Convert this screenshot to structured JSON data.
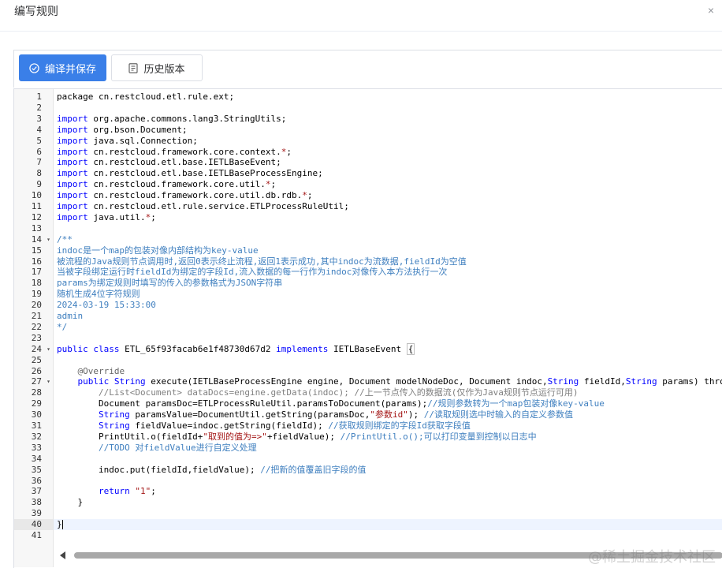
{
  "dialog": {
    "title": "编写规则",
    "close_glyph": "×"
  },
  "toolbar": {
    "save_label": "编译并保存",
    "history_label": "历史版本"
  },
  "colors": {
    "primary": "#3a7fe8",
    "keyword": "#0000ff",
    "comment": "#3f7fbf",
    "string": "#a31515"
  },
  "editor": {
    "active_line": 40,
    "fold_lines": [
      14,
      24,
      27
    ],
    "lines": [
      [
        {
          "t": "package cn.restcloud.etl.rule.ext;"
        }
      ],
      [],
      [
        {
          "t": "import",
          "c": "k"
        },
        {
          "t": " org.apache.commons.lang3.StringUtils;"
        }
      ],
      [
        {
          "t": "import",
          "c": "k"
        },
        {
          "t": " org.bson.Document;"
        }
      ],
      [
        {
          "t": "import",
          "c": "k"
        },
        {
          "t": " java.sql.Connection;"
        }
      ],
      [
        {
          "t": "import",
          "c": "k"
        },
        {
          "t": " cn.restcloud.framework.core.context."
        },
        {
          "t": "*",
          "c": "s"
        },
        {
          "t": ";"
        }
      ],
      [
        {
          "t": "import",
          "c": "k"
        },
        {
          "t": " cn.restcloud.etl.base.IETLBaseEvent;"
        }
      ],
      [
        {
          "t": "import",
          "c": "k"
        },
        {
          "t": " cn.restcloud.etl.base.IETLBaseProcessEngine;"
        }
      ],
      [
        {
          "t": "import",
          "c": "k"
        },
        {
          "t": " cn.restcloud.framework.core.util."
        },
        {
          "t": "*",
          "c": "s"
        },
        {
          "t": ";"
        }
      ],
      [
        {
          "t": "import",
          "c": "k"
        },
        {
          "t": " cn.restcloud.framework.core.util.db.rdb."
        },
        {
          "t": "*",
          "c": "s"
        },
        {
          "t": ";"
        }
      ],
      [
        {
          "t": "import",
          "c": "k"
        },
        {
          "t": " cn.restcloud.etl.rule.service.ETLProcessRuleUtil;"
        }
      ],
      [
        {
          "t": "import",
          "c": "k"
        },
        {
          "t": " java.util."
        },
        {
          "t": "*",
          "c": "s"
        },
        {
          "t": ";"
        }
      ],
      [],
      [
        {
          "t": "/**",
          "c": "c"
        }
      ],
      [
        {
          "t": "indoc是一个map的包装对像内部结构为key-value",
          "c": "c"
        }
      ],
      [
        {
          "t": "被流程的Java规则节点调用时,返回0表示终止流程,返回1表示成功,其中indoc为流数据,fieldId为空值",
          "c": "c"
        }
      ],
      [
        {
          "t": "当被字段绑定运行时fieldId为绑定的字段Id,流入数据的每一行作为indoc对像传入本方法执行一次",
          "c": "c"
        }
      ],
      [
        {
          "t": "params为绑定规则时填写的传入的参数格式为JSON字符串",
          "c": "c"
        }
      ],
      [
        {
          "t": "随机生成4位字符规则",
          "c": "c"
        }
      ],
      [
        {
          "t": "2024-03-19 15:33:00",
          "c": "c"
        }
      ],
      [
        {
          "t": "admin",
          "c": "c"
        }
      ],
      [
        {
          "t": "*/",
          "c": "c"
        }
      ],
      [],
      [
        {
          "t": "public class",
          "c": "k"
        },
        {
          "t": " ETL_65f93facab6e1f48730d67d2 "
        },
        {
          "t": "implements",
          "c": "k"
        },
        {
          "t": " IETLBaseEvent "
        },
        {
          "t": "{",
          "c": "brk"
        }
      ],
      [],
      [
        {
          "t": "    "
        },
        {
          "t": "@Override",
          "c": "a"
        }
      ],
      [
        {
          "t": "    "
        },
        {
          "t": "public",
          "c": "k"
        },
        {
          "t": " "
        },
        {
          "t": "String",
          "c": "k"
        },
        {
          "t": " execute(IETLBaseProcessEngine engine, Document modelNodeDoc, Document indoc,"
        },
        {
          "t": "String",
          "c": "k"
        },
        {
          "t": " fieldId,"
        },
        {
          "t": "String",
          "c": "k"
        },
        {
          "t": " params) throws Exception{"
        }
      ],
      [
        {
          "t": "        "
        },
        {
          "t": "//List<Document> dataDocs=engine.getData(indoc); //上一节点传入的数据流(仅作为Java规则节点运行可用)",
          "c": "cg"
        }
      ],
      [
        {
          "t": "        Document paramsDoc=ETLProcessRuleUtil.paramsToDocument(params);"
        },
        {
          "t": "//规则参数转为一个map包装对像key-value",
          "c": "c"
        }
      ],
      [
        {
          "t": "        "
        },
        {
          "t": "String",
          "c": "k"
        },
        {
          "t": " paramsValue=DocumentUtil.getString(paramsDoc,"
        },
        {
          "t": "\"参数id\"",
          "c": "s"
        },
        {
          "t": "); "
        },
        {
          "t": "//读取规则选中时输入的自定义参数值",
          "c": "c"
        }
      ],
      [
        {
          "t": "        "
        },
        {
          "t": "String",
          "c": "k"
        },
        {
          "t": " fieldValue=indoc.getString(fieldId); "
        },
        {
          "t": "//获取规则绑定的字段Id获取字段值",
          "c": "c"
        }
      ],
      [
        {
          "t": "        PrintUtil.o(fieldId+"
        },
        {
          "t": "\"取到的值为=>\"",
          "c": "s"
        },
        {
          "t": "+fieldValue); "
        },
        {
          "t": "//PrintUtil.o();可以打印变量到控制以日志中",
          "c": "c"
        }
      ],
      [
        {
          "t": "        "
        },
        {
          "t": "//TODO 对fieldValue进行自定义处理",
          "c": "c"
        }
      ],
      [],
      [
        {
          "t": "        indoc.put(fieldId,fieldValue); "
        },
        {
          "t": "//把新的值覆盖旧字段的值",
          "c": "c"
        }
      ],
      [],
      [
        {
          "t": "        "
        },
        {
          "t": "return",
          "c": "k"
        },
        {
          "t": " "
        },
        {
          "t": "\"1\"",
          "c": "s"
        },
        {
          "t": ";"
        }
      ],
      [
        {
          "t": "    }"
        }
      ],
      [],
      [
        {
          "t": "}"
        },
        {
          "cursor": true
        }
      ],
      []
    ]
  },
  "watermark": "@稀土掘金技术社区"
}
